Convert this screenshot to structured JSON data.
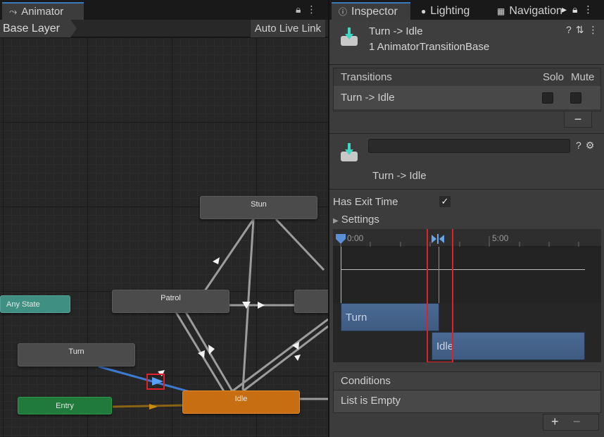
{
  "animator": {
    "tab_title": "Animator",
    "tab_icon": "animator-graph-icon",
    "breadcrumb": "Base Layer",
    "auto_live_link": "Auto Live Link",
    "nodes": {
      "stun": "Stun",
      "any_state": "Any State",
      "patrol": "Patrol",
      "turn": "Turn",
      "entry": "Entry",
      "idle": "Idle"
    },
    "colors": {
      "any_state": "#3f8f83",
      "entry": "#1f7a3b",
      "default_state": "#c86e12",
      "selected_transition": "#3a7ad0",
      "highlight": "#e0202a"
    }
  },
  "inspector": {
    "tabs": [
      {
        "label": "Inspector",
        "icon": "info-icon"
      },
      {
        "label": "Lighting",
        "icon": "lightbulb-icon"
      },
      {
        "label": "Navigation",
        "icon": "navigation-icon"
      }
    ],
    "header": {
      "title": "Turn -> Idle",
      "subtitle": "1 AnimatorTransitionBase"
    },
    "transitions": {
      "header": "Transitions",
      "solo": "Solo",
      "mute": "Mute",
      "row_label": "Turn -> Idle",
      "solo_checked": false,
      "mute_checked": false,
      "remove": "−"
    },
    "transition_detail": {
      "name_value": "",
      "label": "Turn -> Idle"
    },
    "has_exit_time": {
      "label": "Has Exit Time",
      "checked": true
    },
    "settings": {
      "label": "Settings"
    },
    "timeline": {
      "ruler": [
        "0:00",
        "5:00"
      ],
      "clip_from": "Turn",
      "clip_to": "Idle"
    },
    "conditions": {
      "header": "Conditions",
      "empty": "List is Empty",
      "add": "+",
      "remove": "−"
    }
  }
}
